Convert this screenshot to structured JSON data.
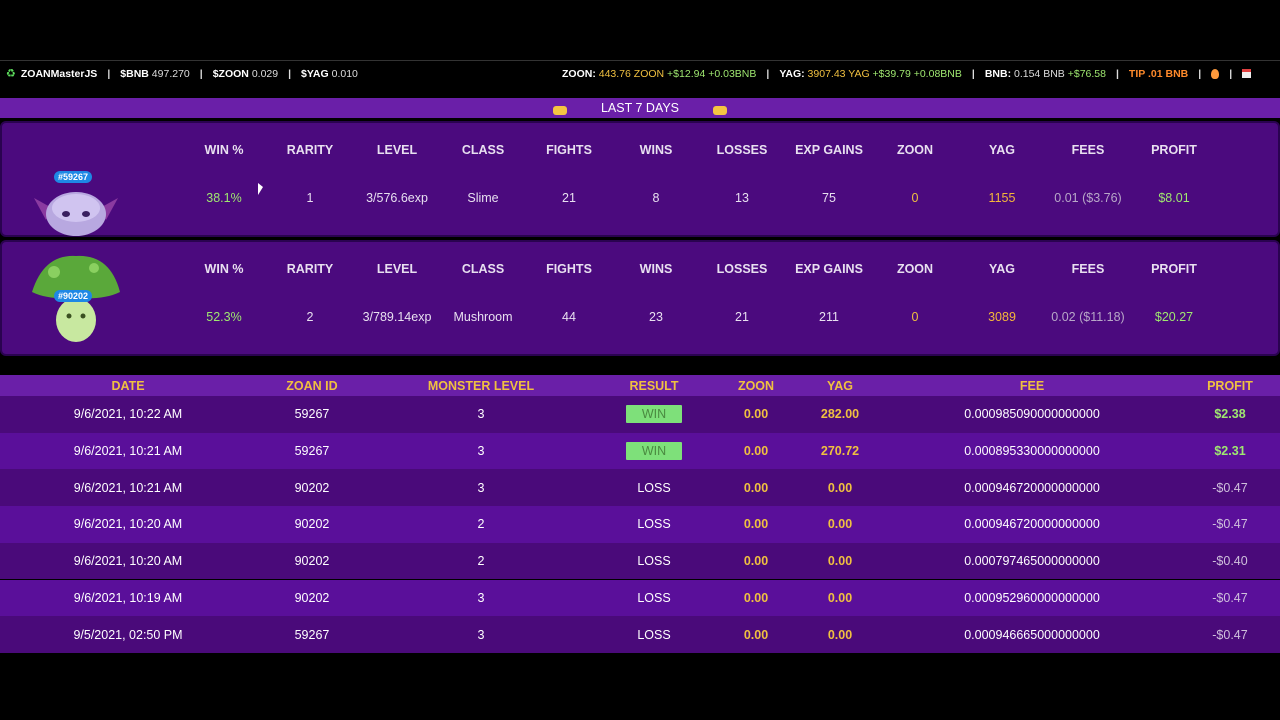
{
  "topbar": {
    "app_name": "ZOANMasterJS",
    "bnb_label": "$BNB",
    "bnb_price": "497.270",
    "zoon_label": "$ZOON",
    "zoon_price": "0.029",
    "yag_label": "$YAG",
    "yag_price": "0.010",
    "zoon_bal_label": "ZOON:",
    "zoon_bal": "443.76 ZOON",
    "zoon_bal_gain": "+$12.94 +0.03BNB",
    "yag_bal_label": "YAG:",
    "yag_bal": "3907.43 YAG",
    "yag_bal_gain": "+$39.79 +0.08BNB",
    "bnb_bal_label": "BNB:",
    "bnb_bal": "0.154 BNB",
    "bnb_bal_gain": "+$76.58",
    "tip": "TIP .01 BNB",
    "separator": "|"
  },
  "period": {
    "label": "LAST 7 DAYS"
  },
  "monster_headers": [
    "WIN %",
    "RARITY",
    "LEVEL",
    "CLASS",
    "FIGHTS",
    "WINS",
    "LOSSES",
    "EXP GAINS",
    "ZOON",
    "YAG",
    "FEES",
    "PROFIT"
  ],
  "monsters": [
    {
      "id": "#59267",
      "win_pct": "38.1%",
      "rarity": "1",
      "level": "3/576.6exp",
      "class": "Slime",
      "fights": "21",
      "wins": "8",
      "losses": "13",
      "exp_gains": "75",
      "zoon": "0",
      "yag": "1155",
      "fees": "0.01 ($3.76)",
      "profit": "$8.01"
    },
    {
      "id": "#90202",
      "win_pct": "52.3%",
      "rarity": "2",
      "level": "3/789.14exp",
      "class": "Mushroom",
      "fights": "44",
      "wins": "23",
      "losses": "21",
      "exp_gains": "211",
      "zoon": "0",
      "yag": "3089",
      "fees": "0.02 ($11.18)",
      "profit": "$20.27"
    }
  ],
  "table": {
    "headers": [
      "DATE",
      "ZOAN ID",
      "MONSTER LEVEL",
      "RESULT",
      "ZOON",
      "YAG",
      "FEE",
      "PROFIT"
    ],
    "rows": [
      {
        "date": "9/6/2021, 10:22 AM",
        "zoan_id": "59267",
        "level": "3",
        "result": "WIN",
        "zoon": "0.00",
        "yag": "282.00",
        "fee": "0.000985090000000000",
        "profit": "$2.38"
      },
      {
        "date": "9/6/2021, 10:21 AM",
        "zoan_id": "59267",
        "level": "3",
        "result": "WIN",
        "zoon": "0.00",
        "yag": "270.72",
        "fee": "0.000895330000000000",
        "profit": "$2.31"
      },
      {
        "date": "9/6/2021, 10:21 AM",
        "zoan_id": "90202",
        "level": "3",
        "result": "LOSS",
        "zoon": "0.00",
        "yag": "0.00",
        "fee": "0.000946720000000000",
        "profit": "-$0.47"
      },
      {
        "date": "9/6/2021, 10:20 AM",
        "zoan_id": "90202",
        "level": "2",
        "result": "LOSS",
        "zoon": "0.00",
        "yag": "0.00",
        "fee": "0.000946720000000000",
        "profit": "-$0.47"
      },
      {
        "date": "9/6/2021, 10:20 AM",
        "zoan_id": "90202",
        "level": "2",
        "result": "LOSS",
        "zoon": "0.00",
        "yag": "0.00",
        "fee": "0.000797465000000000",
        "profit": "-$0.40"
      },
      {
        "date": "9/6/2021, 10:19 AM",
        "zoan_id": "90202",
        "level": "3",
        "result": "LOSS",
        "zoon": "0.00",
        "yag": "0.00",
        "fee": "0.000952960000000000",
        "profit": "-$0.47"
      },
      {
        "date": "9/5/2021, 02:50 PM",
        "zoan_id": "59267",
        "level": "3",
        "result": "LOSS",
        "zoon": "0.00",
        "yag": "0.00",
        "fee": "0.000946665000000000",
        "profit": "-$0.47"
      }
    ]
  },
  "colors": {
    "purple_band": "#6a1fa8",
    "card_bg": "#4b0a7e",
    "gold": "#f0c040",
    "green": "#9fe870",
    "tip_orange": "#ff8a2b"
  },
  "icons": [
    "recycle-icon",
    "pointing-hand-icon",
    "flame-icon",
    "calendar-icon",
    "mouse-cursor-icon"
  ]
}
